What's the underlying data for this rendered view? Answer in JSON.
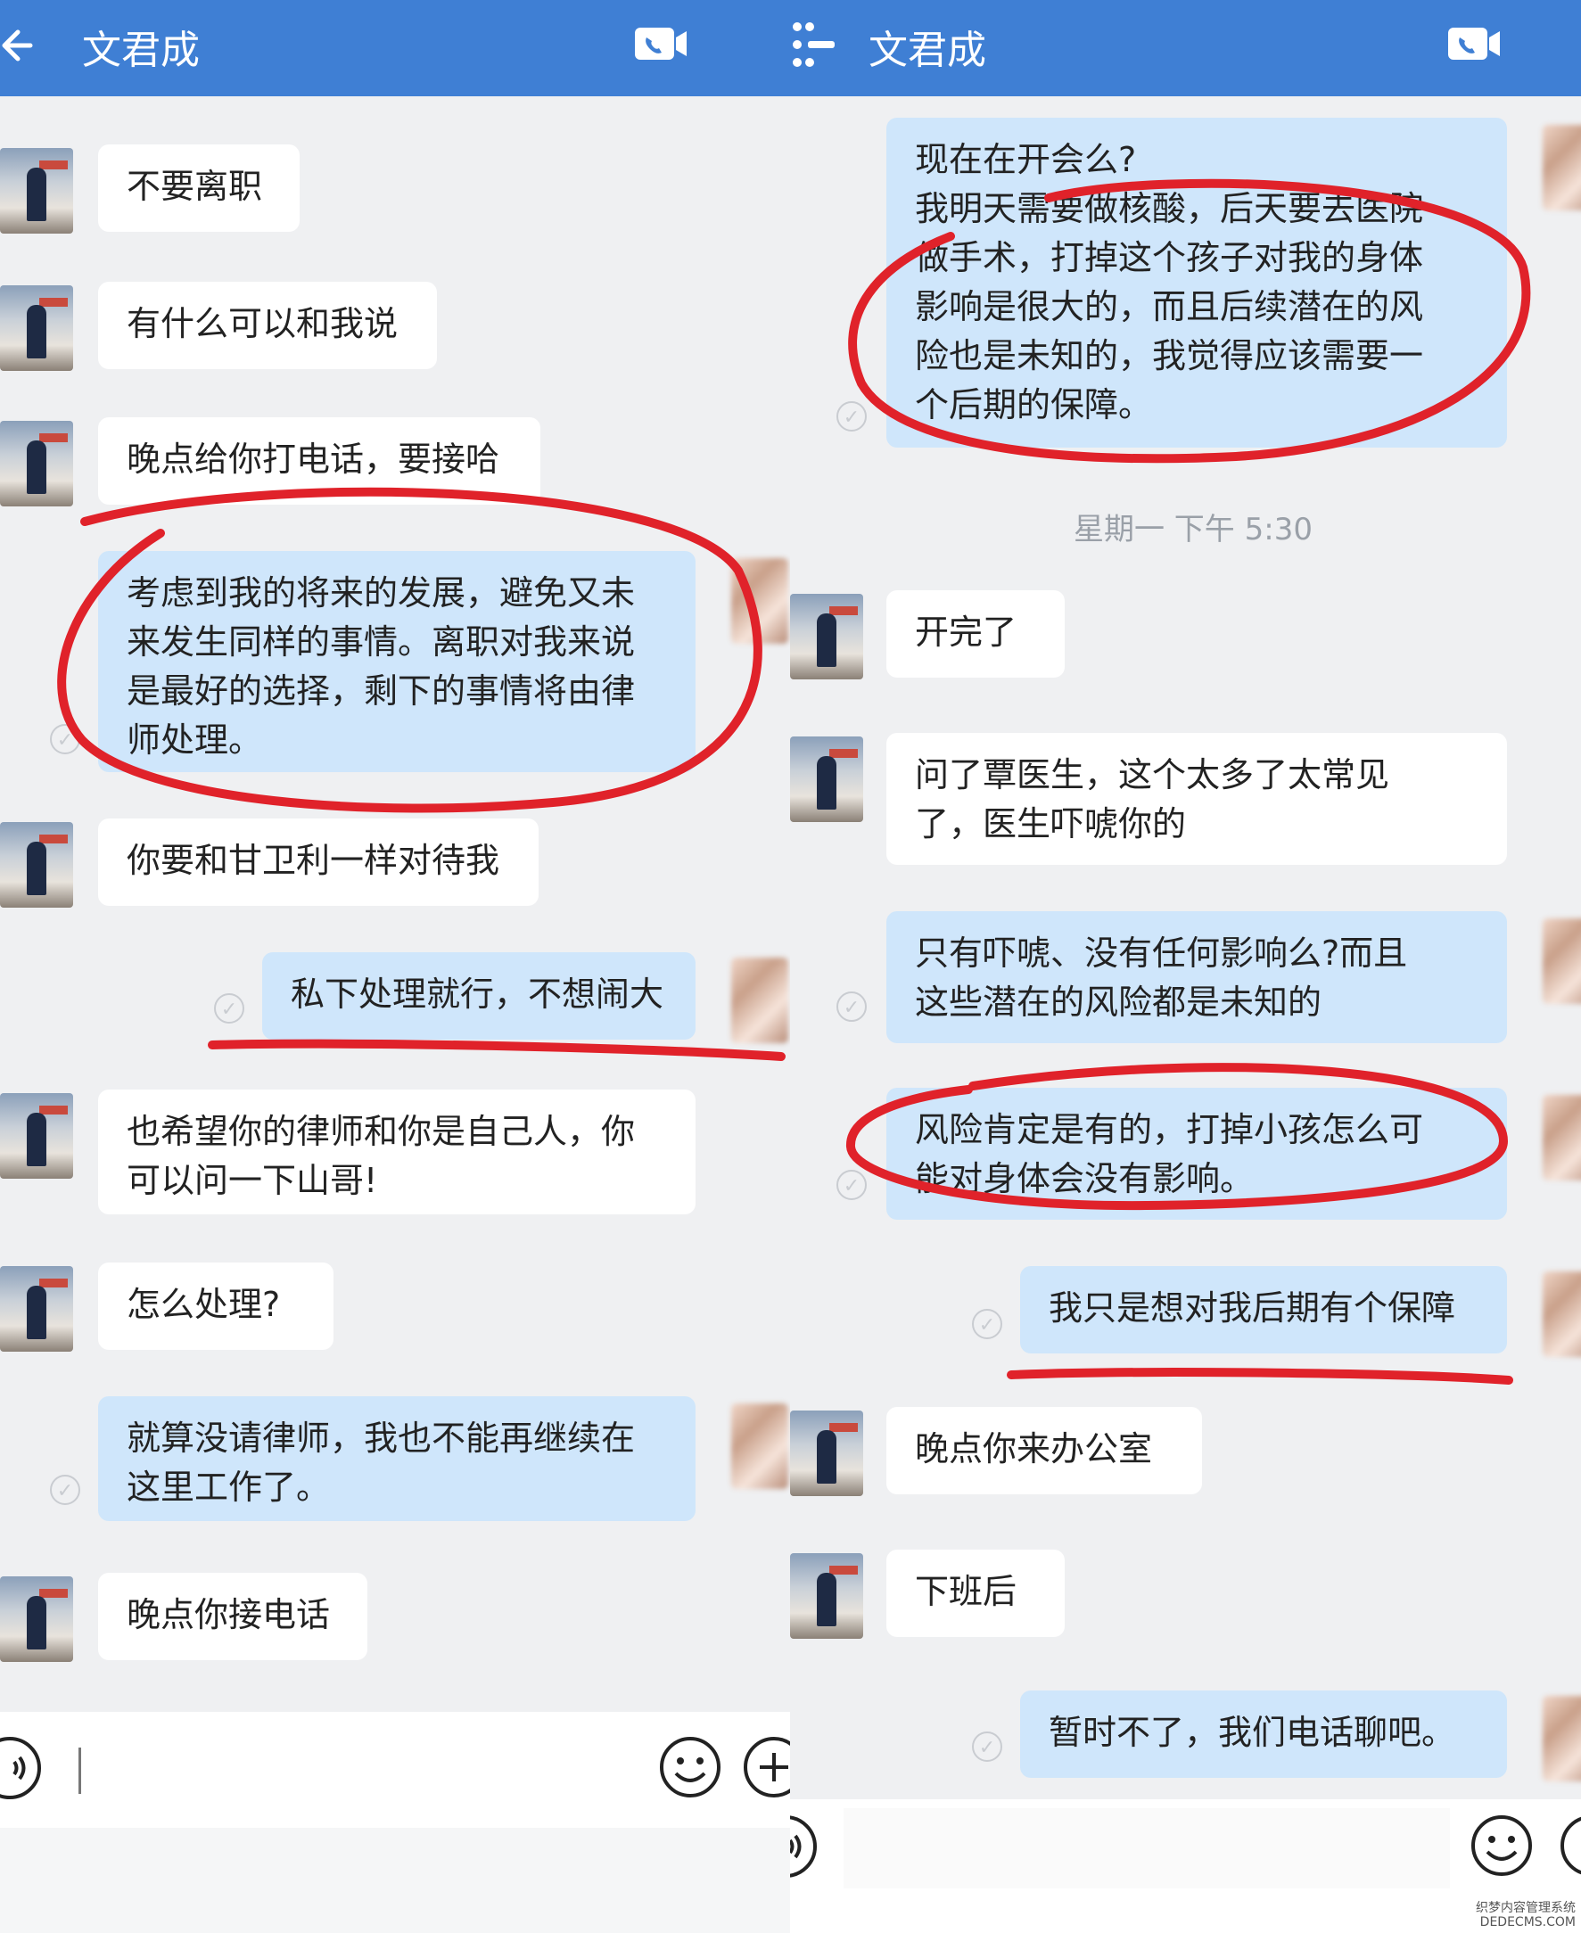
{
  "left": {
    "header": {
      "title": "文君成"
    },
    "messages": [
      {
        "text": "不要离职"
      },
      {
        "text": "有什么可以和我说"
      },
      {
        "text": "晚点给你打电话，要接哈"
      },
      {
        "text": "考虑到我的将来的发展，避免又未\n来发生同样的事情。离职对我来说\n是最好的选择，剩下的事情将由律\n师处理。"
      },
      {
        "text": "你要和甘卫利一样对待我"
      },
      {
        "text": "私下处理就行，不想闹大"
      },
      {
        "text": "也希望你的律师和你是自己人，你\n可以问一下山哥!"
      },
      {
        "text": "怎么处理?"
      },
      {
        "text": "就算没请律师，我也不能再继续在\n这里工作了。"
      },
      {
        "text": "晚点你接电话"
      }
    ]
  },
  "right": {
    "header": {
      "title": "文君成"
    },
    "timestamp": "星期一  下午 5:30",
    "messages": [
      {
        "text": "现在在开会么?\n我明天需要做核酸，后天要去医院\n做手术，打掉这个孩子对我的身体\n影响是很大的，而且后续潜在的风\n险也是未知的，我觉得应该需要一\n个后期的保障。"
      },
      {
        "text": "开完了"
      },
      {
        "text": "问了覃医生，这个太多了太常见\n了，医生吓唬你的"
      },
      {
        "text": "只有吓唬、没有任何影响么?而且\n这些潜在的风险都是未知的"
      },
      {
        "text": "风险肯定是有的，打掉小孩怎么可\n能对身体会没有影响。"
      },
      {
        "text": "我只是想对我后期有个保障"
      },
      {
        "text": "晚点你来办公室"
      },
      {
        "text": "下班后"
      },
      {
        "text": "暂时不了，我们电话聊吧。"
      }
    ]
  },
  "watermark": {
    "line1": "织梦内容管理系统",
    "line2": "DEDECMS.COM"
  },
  "colors": {
    "topbar": "#3f7fd4",
    "outgoing_bubble": "#cfe6fb",
    "incoming_bubble": "#ffffff",
    "annotation": "#e0222a",
    "background": "#eff0f2"
  },
  "icons": [
    "back-arrow-icon",
    "video-call-icon",
    "menu-icon",
    "voice-icon",
    "emoji-icon",
    "plus-icon",
    "check-icon"
  ]
}
